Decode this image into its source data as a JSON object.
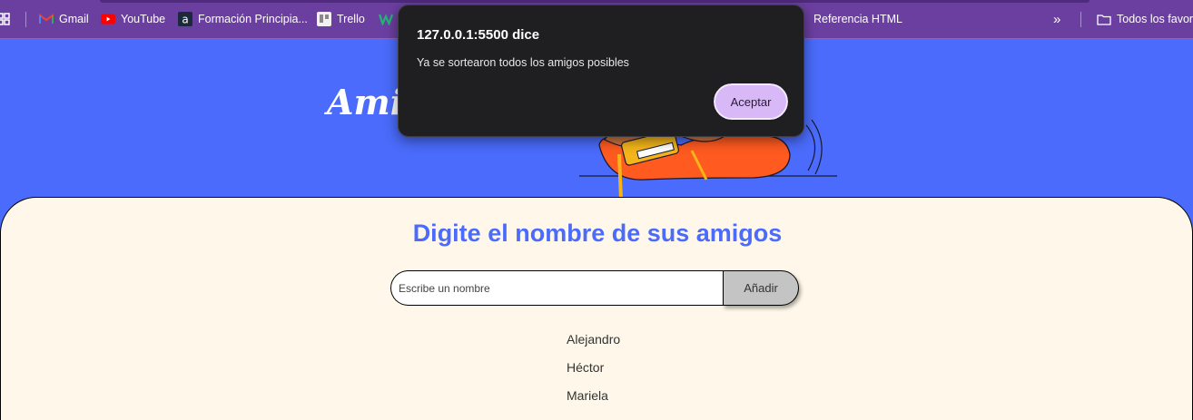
{
  "bookmarks": {
    "items": [
      {
        "label": "Gmail",
        "icon": "gmail-icon"
      },
      {
        "label": "YouTube",
        "icon": "youtube-icon"
      },
      {
        "label": "Formación Principia...",
        "icon": "a-icon"
      },
      {
        "label": "Trello",
        "icon": "trello-icon"
      },
      {
        "label": "Referencia HTML",
        "icon": "w-icon"
      }
    ],
    "more": "»",
    "all_bookmarks": "Todos los favori"
  },
  "hero": {
    "title": "Amig"
  },
  "main": {
    "heading": "Digite el nombre de sus amigos",
    "input_placeholder": "Escribe un nombre",
    "add_label": "Añadir",
    "friends": [
      "Alejandro",
      "Héctor",
      "Mariela"
    ]
  },
  "dialog": {
    "title": "127.0.0.1:5500 dice",
    "message": "Ya se sortearon todos los amigos posibles",
    "ok_label": "Aceptar"
  },
  "colors": {
    "hero_bg": "#4a6bfb",
    "card_bg": "#fff8ea",
    "heading": "#4a6bfb",
    "bookmarks_bg": "#6b3fa0",
    "dialog_bg": "#1f1e21",
    "dialog_button": "#d9b8f7"
  }
}
